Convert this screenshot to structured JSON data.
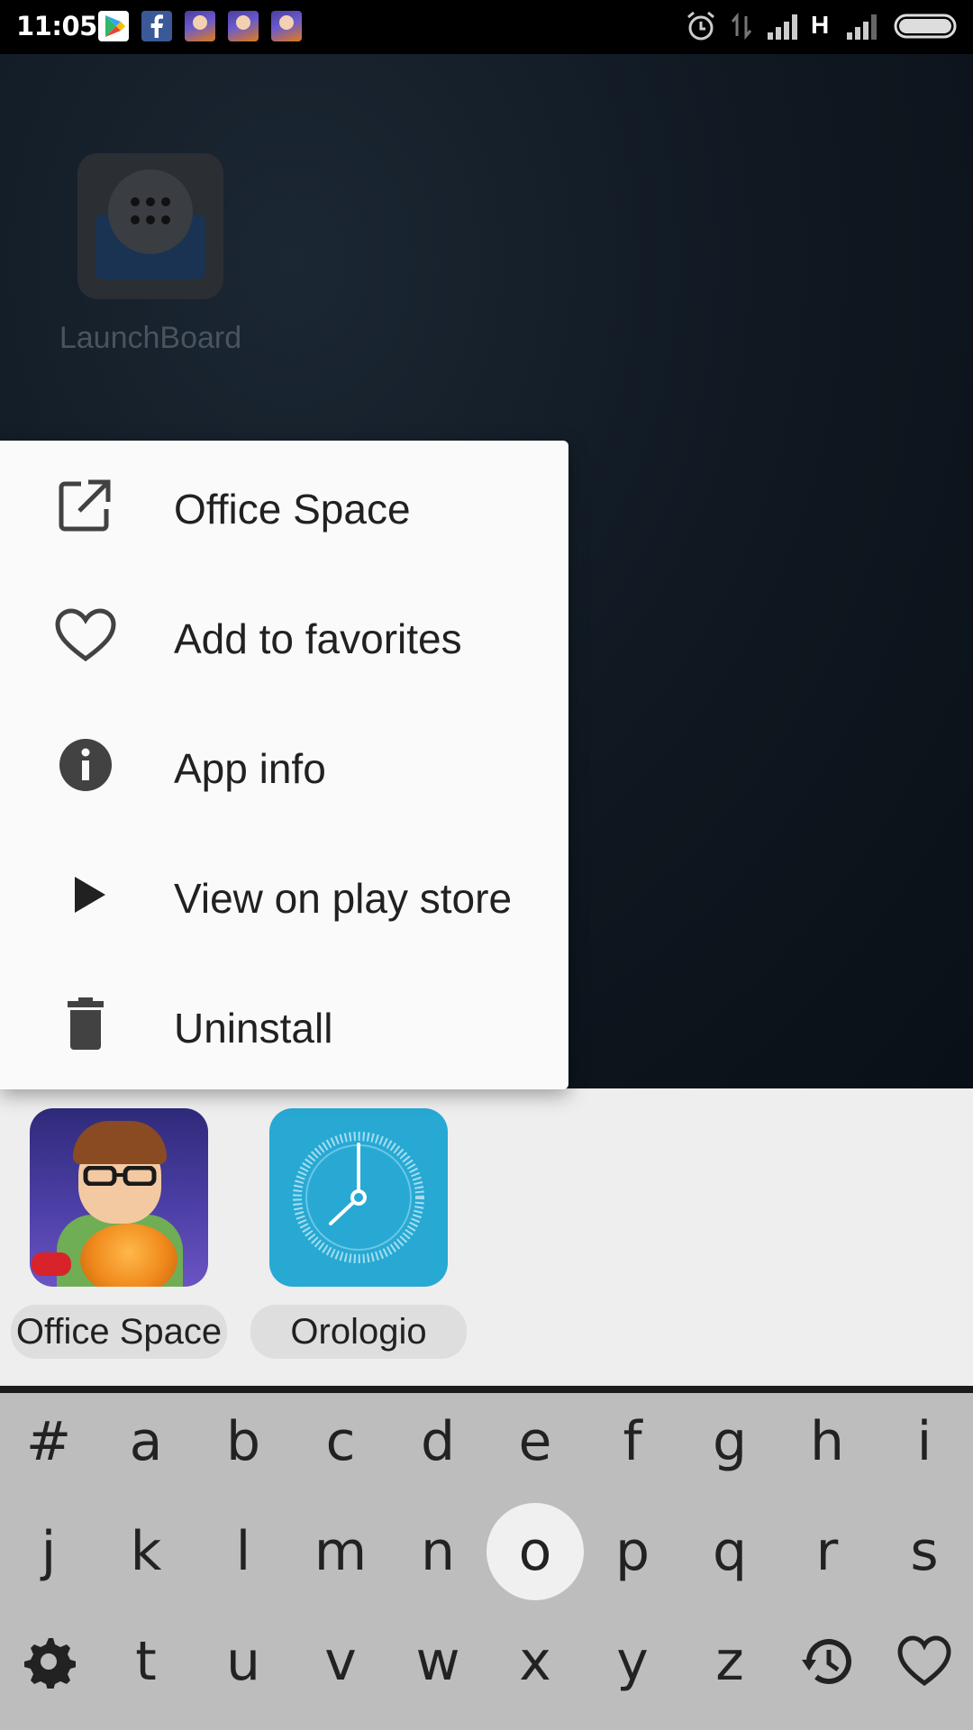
{
  "status_bar": {
    "time": "11:05",
    "network_type": "H",
    "notifications": [
      "play-store-icon",
      "facebook-icon",
      "office-space-game-icon",
      "office-space-game-icon",
      "office-space-game-icon"
    ],
    "right_icons": [
      "alarm-icon",
      "data-arrows-icon",
      "signal-icon",
      "signal-icon",
      "battery-icon"
    ]
  },
  "home": {
    "app_label": "LaunchBoard"
  },
  "context_menu": {
    "items": [
      {
        "label": "Office Space",
        "icon": "open-external-icon"
      },
      {
        "label": "Add to favorites",
        "icon": "heart-outline-icon"
      },
      {
        "label": "App info",
        "icon": "info-icon"
      },
      {
        "label": "View on play store",
        "icon": "play-arrow-icon"
      },
      {
        "label": "Uninstall",
        "icon": "trash-icon"
      }
    ]
  },
  "results": {
    "apps": [
      {
        "label": "Office Space",
        "icon": "office-space-app-icon"
      },
      {
        "label": "Orologio",
        "icon": "clock-app-icon"
      }
    ]
  },
  "keyboard": {
    "rows": [
      [
        "#",
        "a",
        "b",
        "c",
        "d",
        "e",
        "f",
        "g",
        "h",
        "i"
      ],
      [
        "j",
        "k",
        "l",
        "m",
        "n",
        "o",
        "p",
        "q",
        "r",
        "s"
      ],
      [
        "settings-icon",
        "t",
        "u",
        "v",
        "w",
        "x",
        "y",
        "z",
        "history-icon",
        "heart-outline-icon"
      ]
    ],
    "selected_key": "o"
  },
  "colors": {
    "menu_background": "#fafafa",
    "results_background": "#eeeeee",
    "keyboard_background": "#bdbdbd",
    "selected_key_background": "#f0f0f0",
    "clock_icon": "#27a9d4"
  }
}
